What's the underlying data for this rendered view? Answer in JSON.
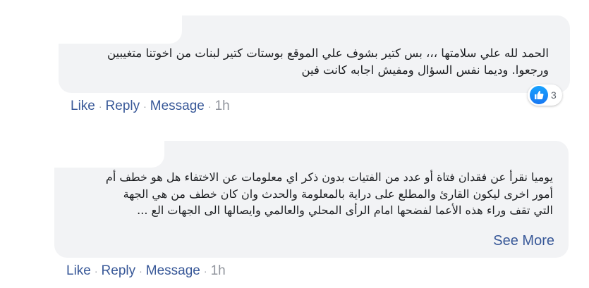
{
  "comments": [
    {
      "lines": [
        "الحمد لله علي سلامتها ،،، بس كتير بشوف علي الموقع بوستات كتير لبنات من اخوتنا متغيبين",
        "ورجعوا. وديما نفس السؤال ومفيش اجابه كانت فين"
      ],
      "reactions": {
        "icon": "like-icon",
        "count": "3"
      },
      "actions": {
        "like": "Like",
        "reply": "Reply",
        "message": "Message",
        "time": "1h",
        "separator": "·"
      }
    },
    {
      "lines": [
        "يوميا نقرأ عن فقدان فتاة أو عدد من الفتيات بدون ذكر اي معلومات عن الاختفاء هل هو خطف أم",
        "أمور اخرى ليكون القارئ والمطلع على دراية بالمعلومة والحدث وان كان خطف من هي الجهة",
        "التي تقف وراء هذه الأعما لفضحها امام الرأى المحلي والعالمي وايصالها الى الجهات الع ..."
      ],
      "see_more": "See More",
      "actions": {
        "like": "Like",
        "reply": "Reply",
        "message": "Message",
        "time": "1h",
        "separator": "·"
      }
    }
  ],
  "colors": {
    "link": "#385898",
    "meta": "#90949c",
    "bubble": "#f2f3f5",
    "like_blue": "#1877f2"
  }
}
